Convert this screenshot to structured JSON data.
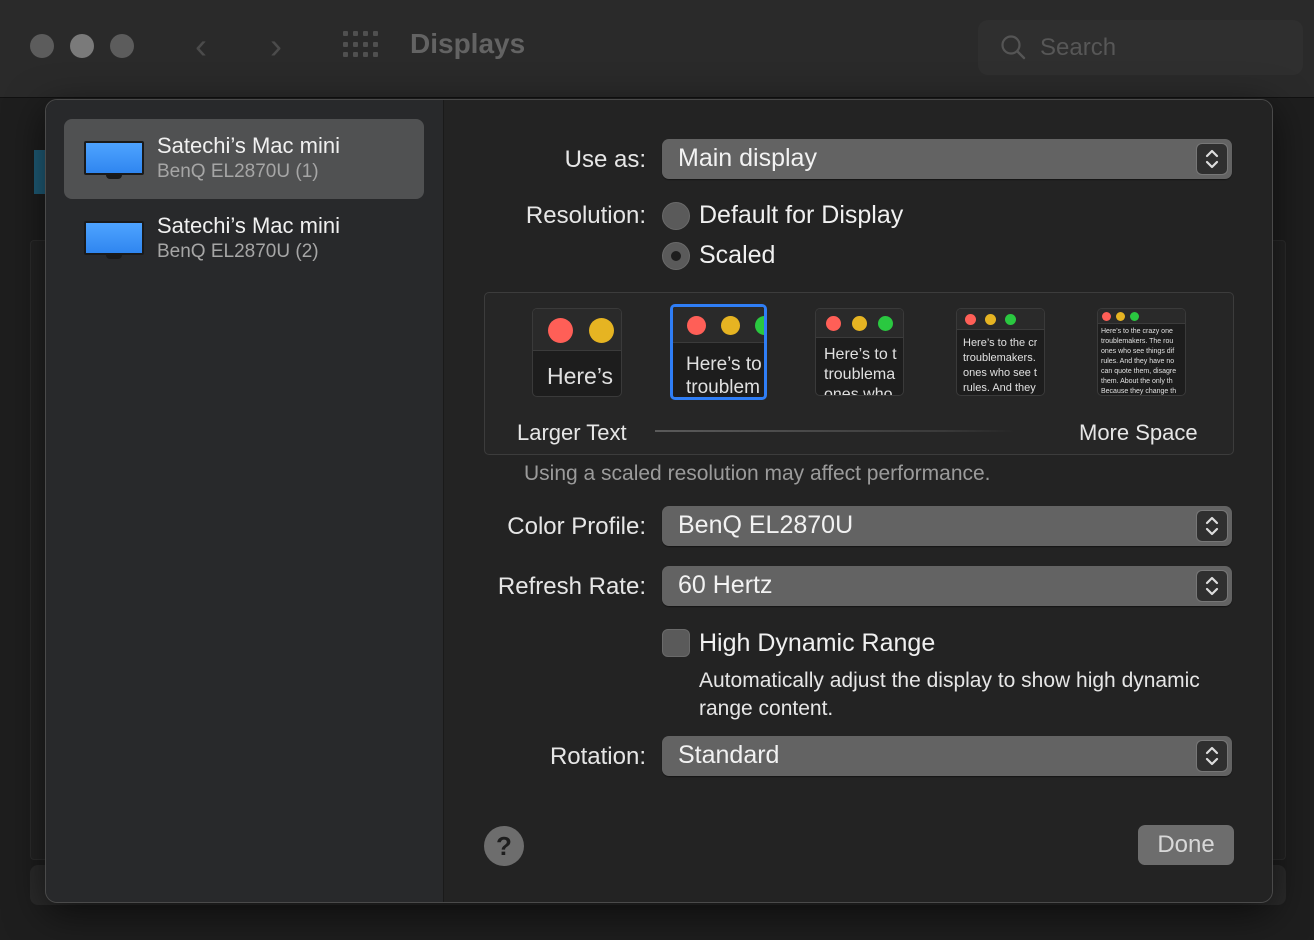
{
  "window": {
    "title": "Displays",
    "search_placeholder": "Search"
  },
  "sidebar": {
    "items": [
      {
        "name": "Satechi’s Mac mini",
        "subtitle": "BenQ EL2870U (1)",
        "selected": true
      },
      {
        "name": "Satechi’s Mac mini",
        "subtitle": "BenQ EL2870U (2)",
        "selected": false
      }
    ]
  },
  "settings": {
    "use_as": {
      "label": "Use as:",
      "value": "Main display"
    },
    "resolution": {
      "label": "Resolution:",
      "options": [
        {
          "label": "Default for Display",
          "selected": false
        },
        {
          "label": "Scaled",
          "selected": true
        }
      ]
    },
    "scale": {
      "left_label": "Larger Text",
      "right_label": "More Space",
      "selected_index": 1,
      "thumbs": [
        {
          "text": "Here’s"
        },
        {
          "text": "Here’s to\ntroublem"
        },
        {
          "text": "Here’s to t\ntroublema\nones who"
        },
        {
          "text": "Here’s to the cr\ntroublemakers.\nones who see t\nrules. And they"
        },
        {
          "text": "Here’s to the crazy one\ntroublemakers. The rou\nones who see things dif\nrules. And they have no\ncan quote them, disagre\nthem. About the only th\nBecause they change th"
        }
      ]
    },
    "scale_note": "Using a scaled resolution may affect performance.",
    "color_profile": {
      "label": "Color Profile:",
      "value": "BenQ EL2870U"
    },
    "refresh_rate": {
      "label": "Refresh Rate:",
      "value": "60 Hertz"
    },
    "hdr": {
      "label": "High Dynamic Range",
      "description": "Automatically adjust the display to show high dynamic range content.",
      "checked": false
    },
    "rotation": {
      "label": "Rotation:",
      "value": "Standard"
    }
  },
  "buttons": {
    "help": "?",
    "done": "Done"
  },
  "colors": {
    "accent": "#2f7ef6",
    "traffic_red": "#ff5f57",
    "traffic_yellow": "#e6b422",
    "traffic_green": "#2ac840"
  }
}
